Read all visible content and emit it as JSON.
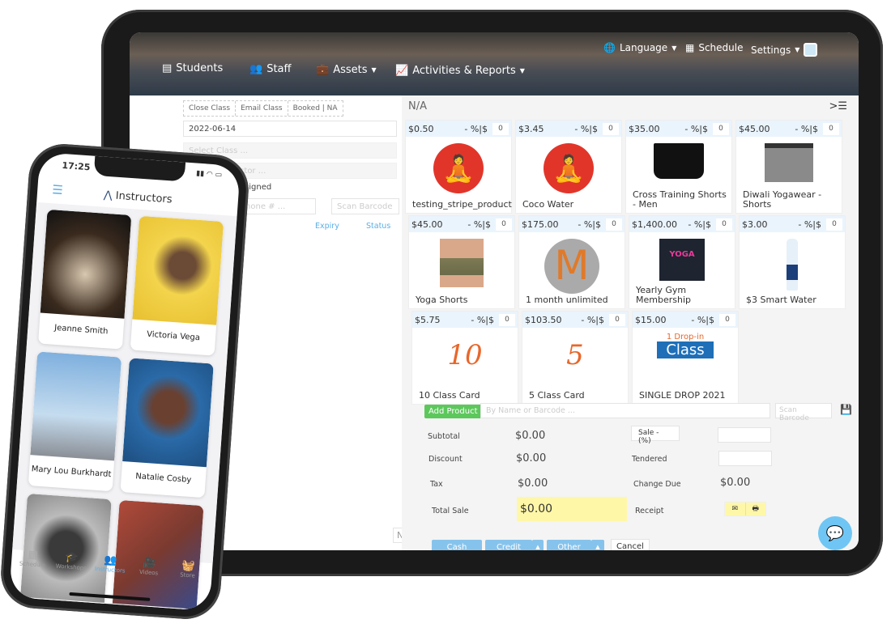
{
  "tablet": {
    "header": {
      "language": "Language",
      "schedule": "Schedule",
      "settings": "Settings",
      "nav": [
        "Students",
        "Staff",
        "Assets",
        "Activities & Reports"
      ]
    },
    "left": {
      "buttons": [
        "Close Class",
        "Email Class",
        "Booked | NA"
      ],
      "date": "2022-06-14",
      "select_class": "Select Class ...",
      "select_instructor": "Select Instructor ...",
      "assigned": "Assigned",
      "phone_placeholder": "Phone # ...",
      "scan_placeholder": "Scan Barcode",
      "cols": [
        "Expiry",
        "Status"
      ],
      "na": "N/A"
    },
    "pos": {
      "title": "N/A",
      "discount_label": "- %|$",
      "products": [
        {
          "price": "$0.50",
          "qty": "0",
          "name": "testing_stripe_product",
          "img": "yoga-logo"
        },
        {
          "price": "$3.45",
          "qty": "0",
          "name": "Coco Water",
          "img": "yoga-logo"
        },
        {
          "price": "$35.00",
          "qty": "0",
          "name": "Cross Training Shorts - Men",
          "img": "black-shorts"
        },
        {
          "price": "$45.00",
          "qty": "0",
          "name": "Diwali Yogawear - Shorts",
          "img": "grey-shorts"
        },
        {
          "price": "$45.00",
          "qty": "0",
          "name": "Yoga Shorts",
          "img": "camo-shorts"
        },
        {
          "price": "$175.00",
          "qty": "0",
          "name": "1 month unlimited",
          "img": "m-logo"
        },
        {
          "price": "$1,400.00",
          "qty": "0",
          "name": "Yearly Gym Membership",
          "img": "tshirt"
        },
        {
          "price": "$3.00",
          "qty": "0",
          "name": "$3 Smart Water",
          "img": "water-bottle"
        },
        {
          "price": "$5.75",
          "qty": "0",
          "name": "10 Class Card",
          "img": "text",
          "imgtext": "10"
        },
        {
          "price": "$103.50",
          "qty": "0",
          "name": "5 Class Card",
          "img": "text",
          "imgtext": "5"
        },
        {
          "price": "$15.00",
          "qty": "0",
          "name": "SINGLE DROP 2021",
          "img": "dropin",
          "imgtext": "1 Drop-in",
          "imgtext2": "Class"
        }
      ],
      "add_product": "Add Product",
      "search_placeholder": "By Name or Barcode ...",
      "scan_placeholder": "Scan Barcode",
      "subtotal_label": "Subtotal",
      "subtotal": "$0.00",
      "discount_text": "Discount",
      "discount": "$0.00",
      "tax_label": "Tax",
      "tax": "$0.00",
      "total_label": "Total Sale",
      "total": "$0.00",
      "sale_button": "Sale - (%)",
      "tendered_label": "Tendered",
      "change_label": "Change Due",
      "change": "$0.00",
      "receipt_label": "Receipt",
      "cash": "Cash",
      "credit": "Credit",
      "other": "Other",
      "cancel": "Cancel"
    }
  },
  "phone": {
    "time": "17:25",
    "title": "Instructors",
    "instructors": [
      "Jeanne Smith",
      "Victoria Vega",
      "Mary Lou Burkhardt",
      "Natalie Cosby"
    ],
    "tabs": [
      "Schedule",
      "Workshops",
      "Instructors",
      "Videos",
      "Store"
    ],
    "active_tab": "Instructors"
  },
  "colors": {
    "accent": "#5aafe6",
    "add_green": "#5cc85c",
    "total_yellow": "#fff7a8",
    "logo_red": "#e2352a"
  }
}
